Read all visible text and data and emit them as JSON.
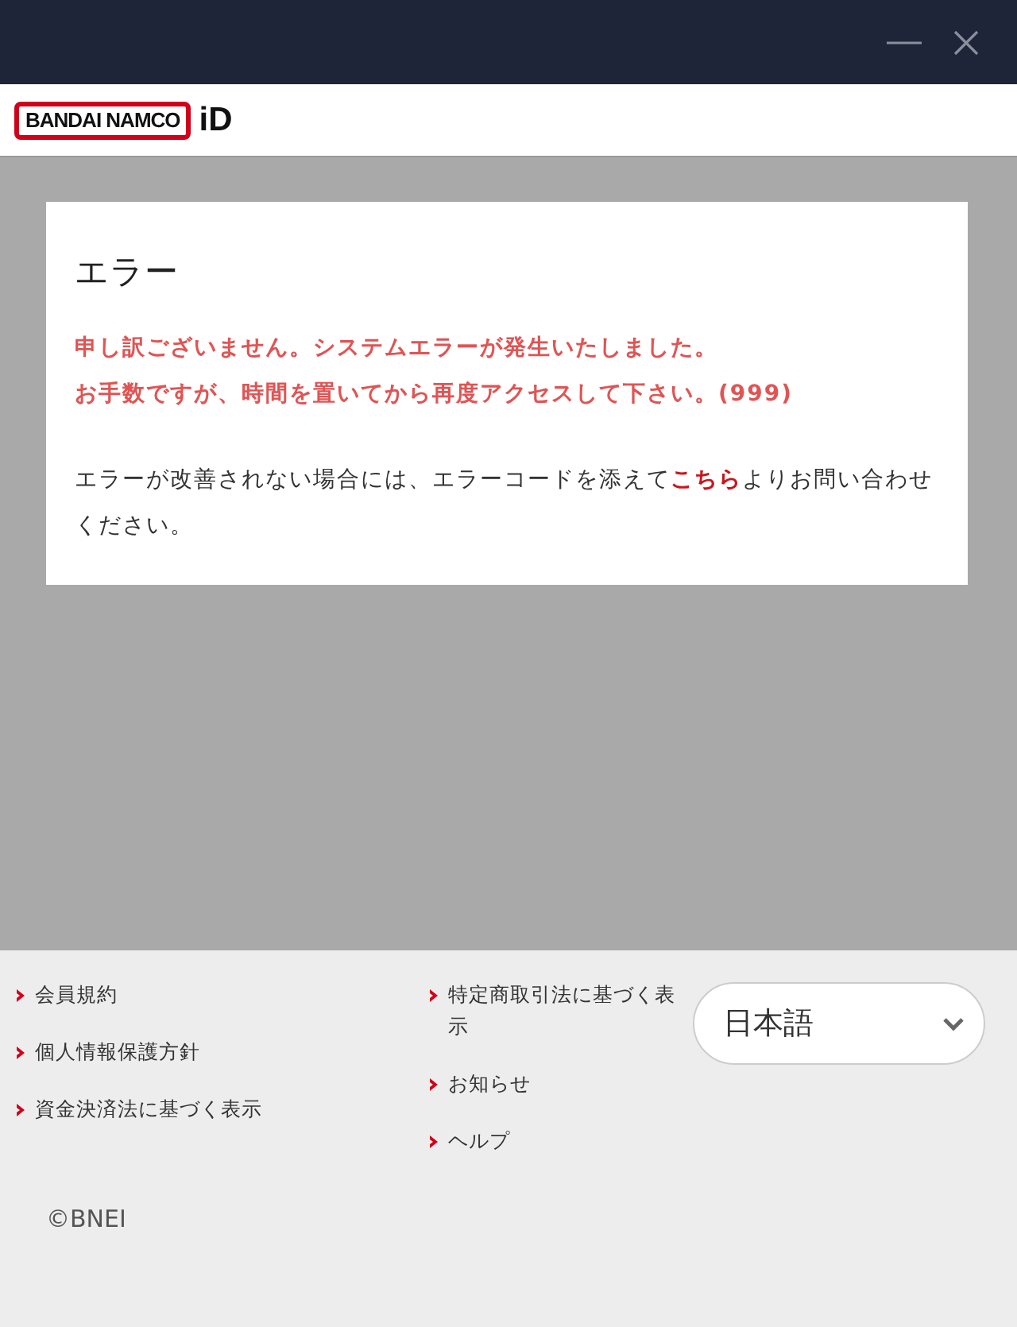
{
  "window": {
    "controls": [
      {
        "kind": "minimize"
      },
      {
        "kind": "close"
      }
    ]
  },
  "header": {
    "logo_text": "BANDAI NAMCO",
    "logo_suffix": "iD"
  },
  "error": {
    "title": "エラー",
    "messages": [
      "申し訳ございません。システムエラーが発生いたしました。",
      "お手数ですが、時間を置いてから再度アクセスして下さい。(999)"
    ],
    "notice": {
      "before": "エラーが改善されない場合には、エラーコードを添えて",
      "link": "こちら",
      "after": "よりお問い合わせください。"
    }
  },
  "footer": {
    "columns": [
      [
        "会員規約",
        "個人情報保護方針",
        "資金決済法に基づく表示"
      ],
      [
        "特定商取引法に基づく表示",
        "お知らせ",
        "ヘルプ"
      ]
    ],
    "language": "日本語",
    "copyright": "©BNEI"
  }
}
